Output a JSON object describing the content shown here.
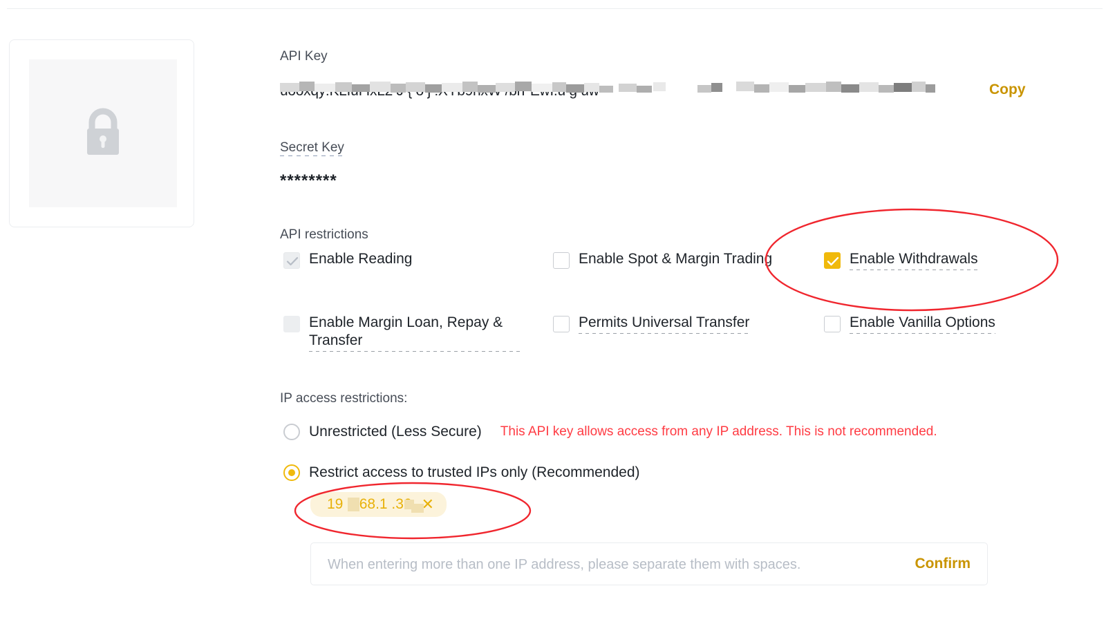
{
  "api_key": {
    "label": "API Key",
    "value": "uooxqy:KLIuI IxL2  J { o j                     :XYb9nxW     /brFEwI.u                      g              uw",
    "copy_label": "Copy"
  },
  "secret_key": {
    "label": "Secret Key",
    "value": "********"
  },
  "restrictions": {
    "label": "API restrictions",
    "items": [
      {
        "label": "Enable Reading",
        "state": "disabled-checked"
      },
      {
        "label": "Enable Spot & Margin Trading",
        "state": "unchecked"
      },
      {
        "label": "Enable Withdrawals",
        "state": "checked"
      },
      {
        "label": "Enable Margin Loan, Repay & Transfer",
        "state": "disabled-unchecked"
      },
      {
        "label": "Permits Universal Transfer",
        "state": "unchecked"
      },
      {
        "label": "Enable Vanilla Options",
        "state": "unchecked"
      }
    ]
  },
  "ip_access": {
    "label": "IP access restrictions:",
    "option_unrestricted": "Unrestricted (Less Secure)",
    "warning": "This API key allows access from any IP address. This is not recommended.",
    "option_restricted": "Restrict access to trusted IPs only (Recommended)",
    "selected": "restricted",
    "tags": [
      {
        "text": "19 .168.1  .36",
        "close": "✕"
      }
    ],
    "input_placeholder": "When entering more than one IP address, please separate them with spaces.",
    "input_value": "",
    "confirm_label": "Confirm"
  },
  "qr_card": {
    "icon": "lock-icon"
  },
  "colors": {
    "accent": "#F0B90B",
    "accent_text": "#C99400",
    "warning": "#FF3B43",
    "annotation": "#F0262E",
    "tag_bg": "#FCF3DB",
    "text": "#1E2329"
  }
}
